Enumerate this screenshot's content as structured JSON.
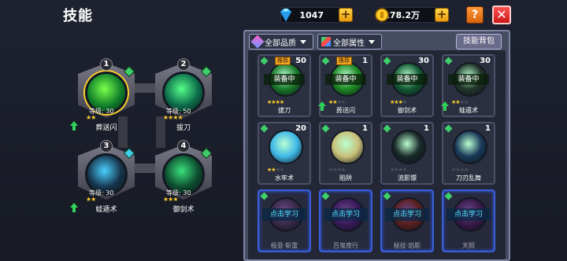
{
  "header": {
    "title": "技能"
  },
  "resources": {
    "gems": {
      "value": "1047",
      "icon": "diamond-icon"
    },
    "gold": {
      "value": "178.2万",
      "icon": "coin-icon"
    },
    "help_label": "?",
    "close_label": "✕"
  },
  "equipped": [
    {
      "slot": "1",
      "name": "葬送闪",
      "level": "等级: 30",
      "stars": 2,
      "orb": "#0f7f2a",
      "glow": "#7dff4a",
      "upgrade": true,
      "gem": "#3fcf6a"
    },
    {
      "slot": "2",
      "name": "拔刀",
      "level": "等级: 50",
      "stars": 4,
      "orb": "#0c6a4a",
      "glow": "#55ff88",
      "upgrade": false,
      "gem": "#3fcf6a"
    },
    {
      "slot": "3",
      "name": "蛙遁术",
      "level": "等级: 30",
      "stars": 2,
      "orb": "#16324a",
      "glow": "#4ad1ff",
      "upgrade": true,
      "gem": "#3fcfe8"
    },
    {
      "slot": "4",
      "name": "御剑术",
      "level": "等级: 30",
      "stars": 3,
      "orb": "#0c4a2e",
      "glow": "#3ae07a",
      "upgrade": false,
      "gem": "#3fcf6a"
    }
  ],
  "filters": {
    "quality_label": "全部品质",
    "attribute_label": "全部属性",
    "bag_label": "技能背包"
  },
  "skills": [
    {
      "name": "拔刀",
      "count": "50",
      "stars": 4,
      "max_stars": 4,
      "equipped_label": "装备中",
      "recommended": "推荐",
      "orb": "#1a7a2a",
      "gem": "#3fcf6a",
      "upgrade": false,
      "locked": false
    },
    {
      "name": "葬送闪",
      "count": "1",
      "stars": 2,
      "max_stars": 4,
      "equipped_label": "装备中",
      "recommended": "推荐",
      "orb": "#1d8a24",
      "gem": "#3fcf6a",
      "upgrade": true,
      "locked": false
    },
    {
      "name": "御剑术",
      "count": "30",
      "stars": 3,
      "max_stars": 4,
      "equipped_label": "装备中",
      "recommended": "",
      "orb": "#145a34",
      "gem": "#3fcf6a",
      "upgrade": false,
      "locked": false
    },
    {
      "name": "蛙遁术",
      "count": "30",
      "stars": 2,
      "max_stars": 4,
      "equipped_label": "装备中",
      "recommended": "",
      "orb": "#23372b",
      "gem": "#3fcf6a",
      "upgrade": true,
      "locked": false
    },
    {
      "name": "水牢术",
      "count": "20",
      "stars": 2,
      "max_stars": 4,
      "equipped_label": "",
      "recommended": "",
      "orb": "#3fb8e8",
      "gem": "#3fcf6a",
      "upgrade": false,
      "locked": false
    },
    {
      "name": "陷阱",
      "count": "1",
      "stars": 0,
      "max_stars": 4,
      "equipped_label": "",
      "recommended": "",
      "orb": "#c8c07a",
      "gem": "#3fcf6a",
      "upgrade": false,
      "locked": false
    },
    {
      "name": "流影镖",
      "count": "1",
      "stars": 0,
      "max_stars": 4,
      "equipped_label": "",
      "recommended": "",
      "orb": "#1a2a2a",
      "gem": "#3fcf6a",
      "upgrade": false,
      "locked": false
    },
    {
      "name": "刀刃乱舞",
      "count": "1",
      "stars": 0,
      "max_stars": 4,
      "equipped_label": "",
      "recommended": "",
      "orb": "#1a3a5a",
      "gem": "#3fcf6a",
      "upgrade": false,
      "locked": false
    },
    {
      "name": "极意·斩雷",
      "count": "",
      "stars": 0,
      "max_stars": 0,
      "learn_label": "点击学习",
      "orb": "#3a2a4a",
      "gem": "#3fcf6a",
      "locked": true
    },
    {
      "name": "百鬼夜行",
      "count": "",
      "stars": 0,
      "max_stars": 0,
      "learn_label": "点击学习",
      "orb": "#3a1a5a",
      "gem": "#3fcf6a",
      "locked": true
    },
    {
      "name": "秘技·焰影",
      "count": "",
      "stars": 0,
      "max_stars": 0,
      "learn_label": "点击学习",
      "orb": "#5a2020",
      "gem": "#3fcf6a",
      "locked": true
    },
    {
      "name": "天照",
      "count": "",
      "stars": 0,
      "max_stars": 0,
      "learn_label": "点击学习",
      "orb": "#3a1a4a",
      "gem": "#3fcf6a",
      "locked": true
    }
  ]
}
